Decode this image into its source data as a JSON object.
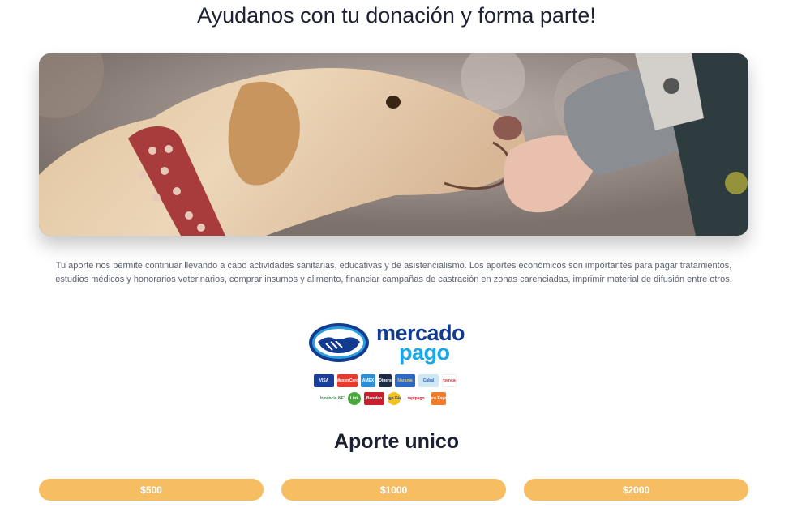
{
  "page": {
    "title": "Ayudanos con tu donación y forma parte!",
    "description": "Tu aporte nos permite continuar llevando a cabo actividades sanitarias, educativas y de asistencialismo. Los aportes económicos son importantes para pagar tratamientos, estudios médicos y honorarios veterinarios, comprar insumos y alimento, financiar campañas de castración en zonas carenciadas, imprimir material de difusión entre otros."
  },
  "payment": {
    "brand_line1": "mercado",
    "brand_line2": "pago",
    "methods_row1": [
      "VISA",
      "MasterCard",
      "AMEX",
      "Diners",
      "Naranja",
      "Cabal",
      "Argencard"
    ],
    "methods_row2": [
      "Provincia NET",
      "Link",
      "Banelco",
      "Pago Fácil",
      "rapipago",
      "Cobro Express"
    ]
  },
  "section": {
    "title": "Aporte unico"
  },
  "amounts": [
    {
      "label": "$500"
    },
    {
      "label": "$1000"
    },
    {
      "label": "$2000"
    }
  ],
  "colors": {
    "button": "#f7bd63",
    "brand_dark": "#123b8f",
    "brand_light": "#1aa7e6"
  }
}
